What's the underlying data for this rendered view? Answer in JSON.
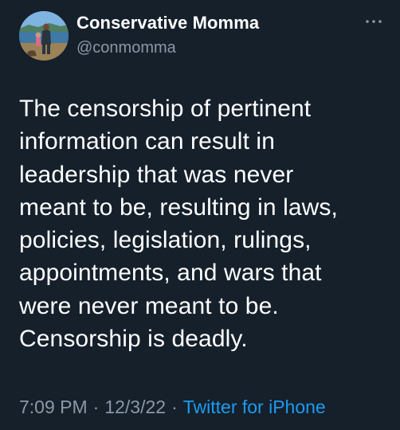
{
  "tweet": {
    "author": {
      "display_name": "Conservative Momma",
      "handle": "@conmomma",
      "avatar_icon": "profile-photo-avatar"
    },
    "more_icon": "more-options-icon",
    "text": "The censorship of pertinent\ninformation can result in\nleadership that was never\nmeant to be, resulting in laws,\npolicies, legislation, rulings,\nappointments, and wars that\nwere never meant to be.\nCensorship is deadly.",
    "time": "7:09 PM",
    "separator": "·",
    "date": "12/3/22",
    "source": "Twitter for iPhone"
  },
  "colors": {
    "background": "#15202b",
    "text_primary": "#ffffff",
    "text_secondary": "#8b98a5",
    "link": "#1d9bf0"
  }
}
